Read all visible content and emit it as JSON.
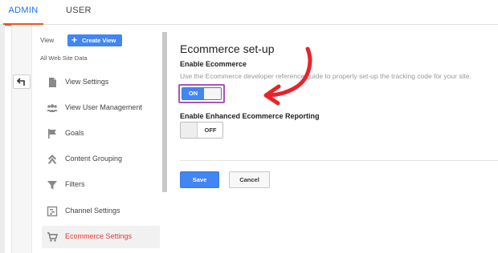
{
  "tabs": {
    "admin": "ADMIN",
    "user": "USER"
  },
  "sidebar": {
    "view_label": "View",
    "create_view_label": "Create View",
    "site_data": "All Web Site Data",
    "items": [
      {
        "label": "View Settings",
        "icon": "document-icon"
      },
      {
        "label": "View User Management",
        "icon": "people-icon"
      },
      {
        "label": "Goals",
        "icon": "flag-icon"
      },
      {
        "label": "Content Grouping",
        "icon": "content-grouping-icon"
      },
      {
        "label": "Filters",
        "icon": "filter-icon"
      },
      {
        "label": "Channel Settings",
        "icon": "channel-settings-icon"
      },
      {
        "label": "Ecommerce Settings",
        "icon": "cart-icon",
        "active": true
      }
    ]
  },
  "main": {
    "title": "Ecommerce set-up",
    "enable_label": "Enable Ecommerce",
    "description": "Use the Ecommerce developer reference guide to properly set-up the tracking code for your site.",
    "ecommerce_toggle": "ON",
    "enhanced_label": "Enable Enhanced Ecommerce Reporting",
    "enhanced_toggle": "OFF",
    "save_label": "Save",
    "cancel_label": "Cancel"
  },
  "colors": {
    "accent_blue": "#4285f4",
    "active_red": "#e53935",
    "tab_underline": "#f4511e",
    "annotation_arrow": "#e8232a",
    "highlight_outline": "#a855b5"
  }
}
